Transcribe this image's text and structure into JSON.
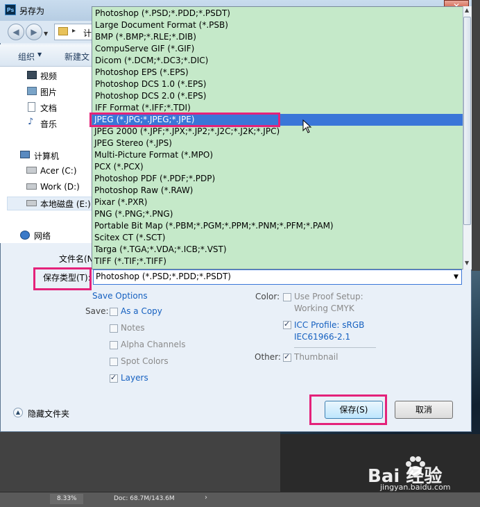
{
  "dialog": {
    "title": "另存为",
    "app_icon": "Ps",
    "close_glyph": "✕"
  },
  "nav": {
    "address_text": "计",
    "back_glyph": "◀",
    "forward_glyph": "▶"
  },
  "toolbar": {
    "organize": "组织",
    "new_folder": "新建文"
  },
  "sidebar": {
    "items": [
      {
        "label": "视频",
        "icon": "video-icon"
      },
      {
        "label": "图片",
        "icon": "pictures-icon"
      },
      {
        "label": "文档",
        "icon": "documents-icon"
      },
      {
        "label": "音乐",
        "icon": "music-icon"
      },
      {
        "label": "计算机",
        "icon": "computer-icon"
      },
      {
        "label": "Acer (C:)",
        "icon": "drive-icon"
      },
      {
        "label": "Work (D:)",
        "icon": "drive-icon"
      },
      {
        "label": "本地磁盘 (E:)",
        "icon": "drive-icon"
      },
      {
        "label": "网络",
        "icon": "network-icon"
      }
    ]
  },
  "file_types": {
    "options": [
      "Photoshop (*.PSD;*.PDD;*.PSDT)",
      "Large Document Format (*.PSB)",
      "BMP (*.BMP;*.RLE;*.DIB)",
      "CompuServe GIF (*.GIF)",
      "Dicom (*.DCM;*.DC3;*.DIC)",
      "Photoshop EPS (*.EPS)",
      "Photoshop DCS 1.0 (*.EPS)",
      "Photoshop DCS 2.0 (*.EPS)",
      "IFF Format (*.IFF;*.TDI)",
      "JPEG (*.JPG;*.JPEG;*.JPE)",
      "JPEG 2000 (*.JPF;*.JPX;*.JP2;*.J2C;*.J2K;*.JPC)",
      "JPEG Stereo (*.JPS)",
      "Multi-Picture Format (*.MPO)",
      "PCX (*.PCX)",
      "Photoshop PDF (*.PDF;*.PDP)",
      "Photoshop Raw (*.RAW)",
      "Pixar (*.PXR)",
      "PNG (*.PNG;*.PNG)",
      "Portable Bit Map (*.PBM;*.PGM;*.PPM;*.PNM;*.PFM;*.PAM)",
      "Scitex CT (*.SCT)",
      "Targa (*.TGA;*.VDA;*.ICB;*.VST)",
      "TIFF (*.TIF;*.TIFF)"
    ],
    "highlighted": "JPEG (*.JPG;*.JPEG;*.JPE)"
  },
  "form": {
    "filename_label": "文件名(N):",
    "savetype_label": "保存类型(T):",
    "savetype_value": "Photoshop (*.PSD;*.PDD;*.PSDT)"
  },
  "save_options": {
    "heading": "Save Options",
    "save_label": "Save:",
    "as_a_copy": "As a Copy",
    "notes": "Notes",
    "alpha_channels": "Alpha Channels",
    "spot_colors": "Spot Colors",
    "layers": "Layers",
    "color_label": "Color:",
    "use_proof_setup": "Use Proof Setup:",
    "working_cmyk": "Working CMYK",
    "icc_profile": "ICC Profile:  sRGB",
    "icc_profile_2": "IEC61966-2.1",
    "other_label": "Other:",
    "thumbnail": "Thumbnail"
  },
  "footer": {
    "hide_folders": "隐藏文件夹",
    "save_button": "保存(S)",
    "cancel_button": "取消"
  },
  "statusbar": {
    "zoom": "8.33%",
    "doc": "Doc: 68.7M/143.6M"
  },
  "watermark": {
    "logo_text": "Bai  经验",
    "url": "jingyan.baidu.com"
  },
  "colors": {
    "list_bg": "#c5e9c9",
    "selection": "#3a76d8",
    "annotation": "#e4227a",
    "link_blue": "#1560c0"
  }
}
